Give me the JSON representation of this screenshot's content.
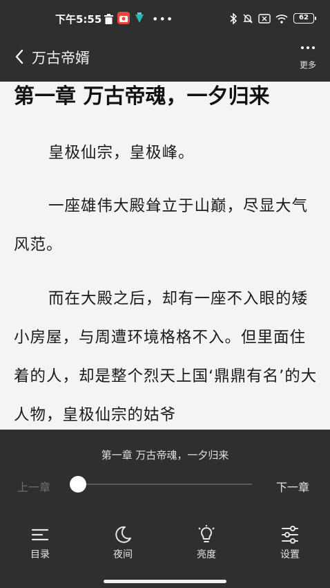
{
  "status_bar": {
    "time": "下午5:55",
    "battery": "62"
  },
  "top_bar": {
    "book_title": "万古帝婿",
    "more_label": "更多"
  },
  "reader": {
    "chapter_heading": "第一章 万古帝魂，一夕归来",
    "paragraphs": [
      "皇极仙宗，皇极峰。",
      "一座雄伟大殿耸立于山巅，尽显大气风范。",
      "而在大殿之后，却有一座不入眼的矮小房屋，与周遭环境格格不入。但里面住着的人，却是整个烈天上国‘鼎鼎有名’的大人物，皇极仙宗的姑爷"
    ]
  },
  "bottom_panel": {
    "current_chapter": "第一章 万古帝魂，一夕归来",
    "prev_label": "上一章",
    "next_label": "下一章",
    "progress": 0.0,
    "tools": {
      "toc": "目录",
      "night": "夜间",
      "brightness": "亮度",
      "settings": "设置"
    }
  },
  "colors": {
    "panel_bg": "#2f2f2f",
    "reader_bg": "#f4f4f4",
    "text": "#1a1a1a"
  }
}
